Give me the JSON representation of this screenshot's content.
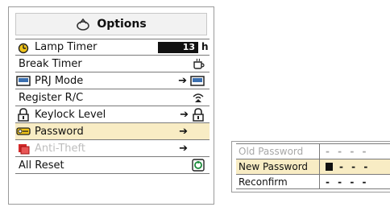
{
  "menu": {
    "title": "Options",
    "title_icon": "options-icon",
    "items": [
      {
        "label": "Lamp Timer",
        "icon": "lamp-timer-icon",
        "value": "13",
        "unit": "h"
      },
      {
        "label": "Break Timer",
        "icon": "",
        "right_icon": "cup-icon"
      },
      {
        "label": "PRJ Mode",
        "icon": "prj-mode-icon",
        "arrow": "➔",
        "right_icon": "prj-mode-icon"
      },
      {
        "label": "Register R/C",
        "icon": "",
        "right_icon": "signal-icon"
      },
      {
        "label": "Keylock Level",
        "icon": "lock-icon",
        "arrow": "➔",
        "right_icon": "lock-icon"
      },
      {
        "label": "Password",
        "icon": "key-icon",
        "arrow": "➔",
        "selected": true
      },
      {
        "label": "Anti-Theft",
        "icon": "anti-theft-icon",
        "arrow": "➔",
        "disabled": true
      },
      {
        "label": "All Reset",
        "icon": "",
        "right_icon": "reset-icon"
      }
    ]
  },
  "submenu": {
    "rows": [
      {
        "label": "Old Password",
        "value": "- - - -",
        "disabled": true
      },
      {
        "label": "New Password",
        "value": "- - -",
        "selected": true
      },
      {
        "label": "Reconfirm",
        "value": "- - - -"
      }
    ]
  }
}
